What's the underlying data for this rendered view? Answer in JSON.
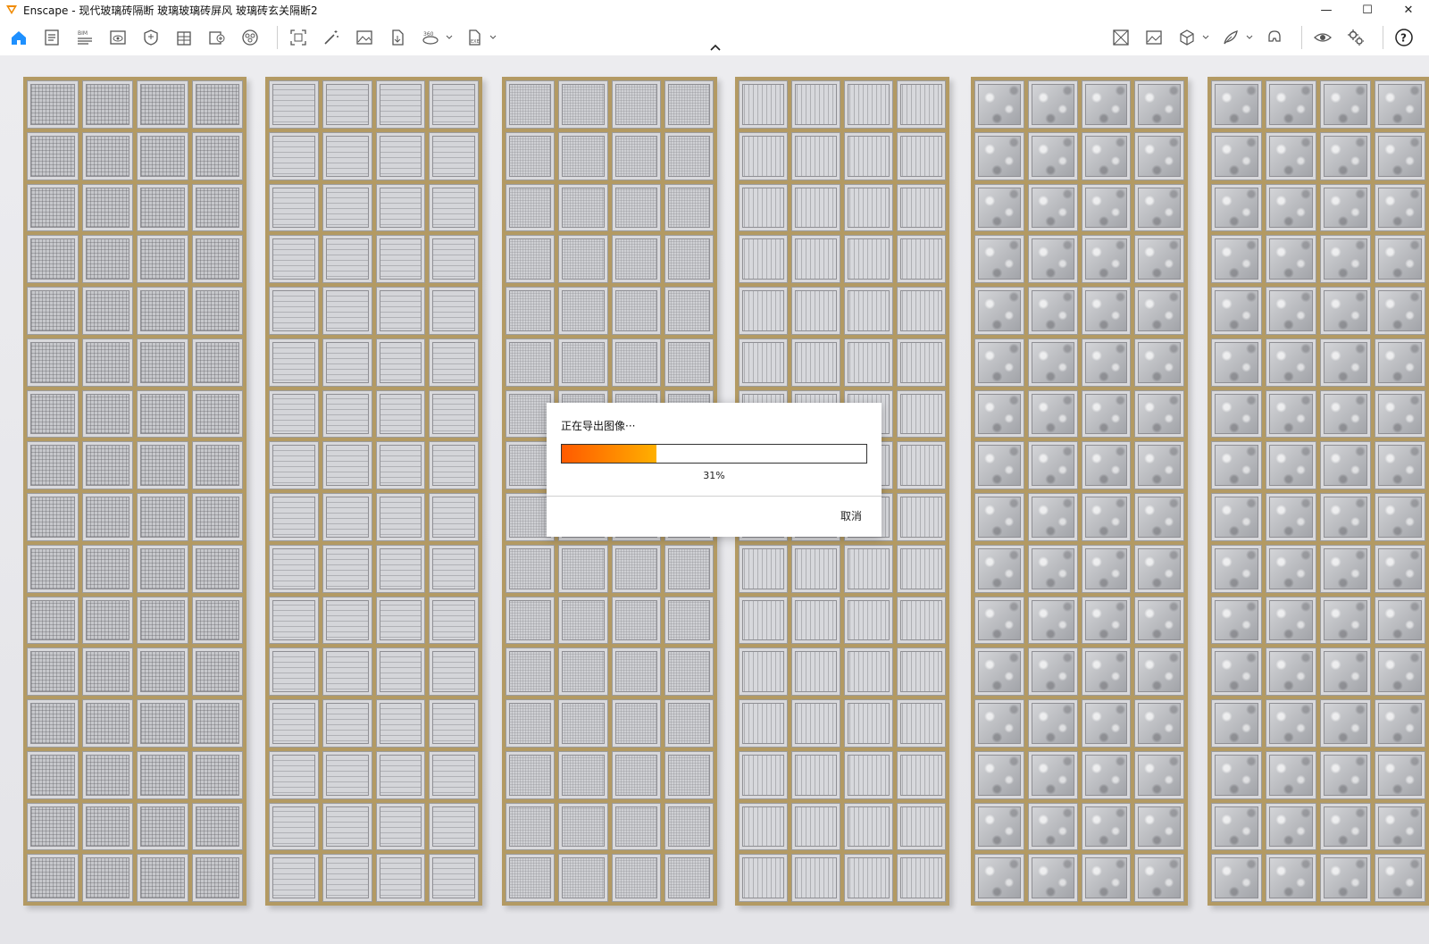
{
  "window": {
    "title": "Enscape - 现代玻璃砖隔断 玻璃玻璃砖屏风 玻璃砖玄关隔断2",
    "accent": "#f08a00"
  },
  "window_controls": {
    "minimize": "—",
    "maximize": "☐",
    "close": "✕"
  },
  "toolbar": {
    "left_icons": [
      "home-icon",
      "document-icon",
      "bim-icon",
      "view-icon",
      "shield-icon",
      "building-icon",
      "asset-library-icon",
      "material-icon",
      "frame-icon",
      "magic-wand-icon",
      "image-icon",
      "export-icon",
      "panorama-360-icon",
      "exe-export-icon"
    ],
    "right_icons": [
      "site-context-icon",
      "capture-icon",
      "cube-icon",
      "feather-icon",
      "vr-headset-icon",
      "eye-icon",
      "settings-icon",
      "help-icon"
    ],
    "bim_label": "BIM",
    "panorama_label": "360",
    "exe_label": "EXE",
    "help_label": "?"
  },
  "panels": [
    {
      "texture": "grid-fine"
    },
    {
      "texture": "horizontal-lines"
    },
    {
      "texture": "grid-dotted"
    },
    {
      "texture": "vertical-lines"
    },
    {
      "texture": "frosted"
    },
    {
      "texture": "frosted"
    }
  ],
  "export_dialog": {
    "title": "正在导出图像···",
    "progress": 31,
    "progress_text": "31%",
    "cancel_label": "取消",
    "fill_color": "#ff7a00"
  }
}
